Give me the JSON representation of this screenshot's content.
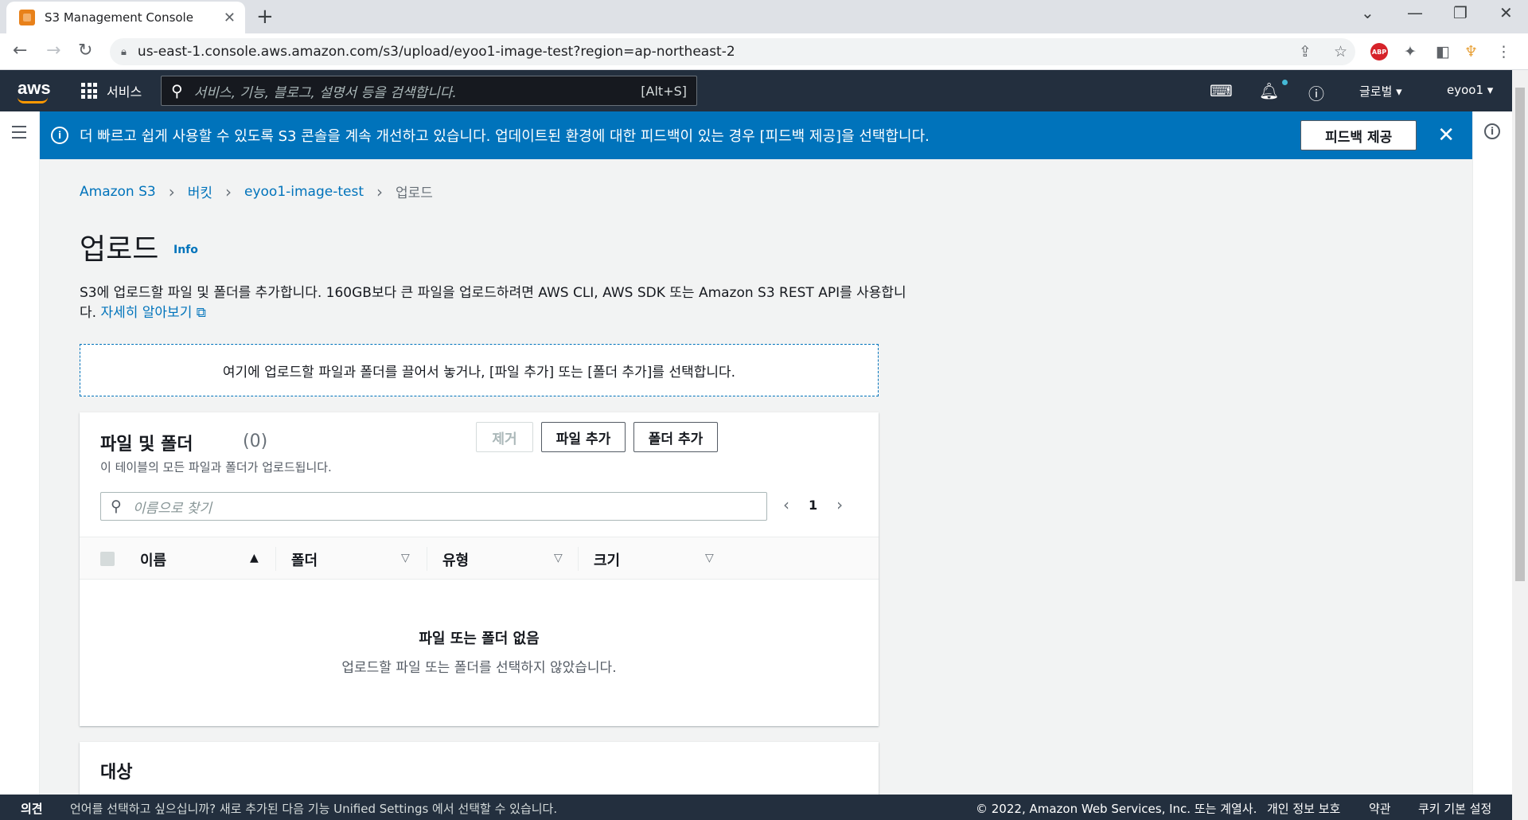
{
  "browser": {
    "tab_title": "S3 Management Console",
    "url": "us-east-1.console.aws.amazon.com/s3/upload/eyoo1-image-test?region=ap-northeast-2"
  },
  "nav": {
    "logo": "aws",
    "services_label": "서비스",
    "search_placeholder": "서비스, 기능, 블로그, 설명서 등을 검색합니다.",
    "search_shortcut": "[Alt+S]",
    "region_label": "글로벌",
    "account_label": "eyoo1"
  },
  "flash": {
    "message": "더 빠르고 쉽게 사용할 수 있도록 S3 콘솔을 계속 개선하고 있습니다. 업데이트된 환경에 대한 피드백이 있는 경우 [피드백 제공]을 선택합니다.",
    "button_label": "피드백 제공"
  },
  "breadcrumb": {
    "items": [
      "Amazon S3",
      "버킷",
      "eyoo1-image-test",
      "업로드"
    ]
  },
  "page": {
    "title": "업로드",
    "info_label": "Info",
    "description": "S3에 업로드할 파일 및 폴더를 추가합니다. 160GB보다 큰 파일을 업로드하려면 AWS CLI, AWS SDK 또는 Amazon S3 REST API를 사용합니다.",
    "learn_more": "자세히 알아보기",
    "dropzone_text": "여기에 업로드할 파일과 폴더를 끌어서 놓거나, [파일 추가] 또는 [폴더 추가]를 선택합니다."
  },
  "files_panel": {
    "title": "파일 및 폴더",
    "count": "(0)",
    "subtitle": "이 테이블의 모든 파일과 폴더가 업로드됩니다.",
    "remove_label": "제거",
    "add_files_label": "파일 추가",
    "add_folder_label": "폴더 추가",
    "search_placeholder": "이름으로 찾기",
    "page_number": "1",
    "columns": [
      "이름",
      "폴더",
      "유형",
      "크기"
    ],
    "empty_title": "파일 또는 폴더 없음",
    "empty_desc": "업로드할 파일 또는 폴더를 선택하지 않았습니다."
  },
  "destination_panel": {
    "title": "대상"
  },
  "footer": {
    "feedback": "의견",
    "language_msg": "언어를 선택하고 싶으십니까? 새로 추가된 다음 기능 Unified Settings 에서 선택할 수 있습니다.",
    "copyright": "© 2022, Amazon Web Services, Inc. 또는 계열사.",
    "privacy": "개인 정보 보호",
    "terms": "약관",
    "cookies": "쿠키 기본 설정"
  },
  "colors": {
    "aws_nav": "#232f3e",
    "accent_blue": "#0073bb",
    "aws_orange": "#ff9900"
  }
}
